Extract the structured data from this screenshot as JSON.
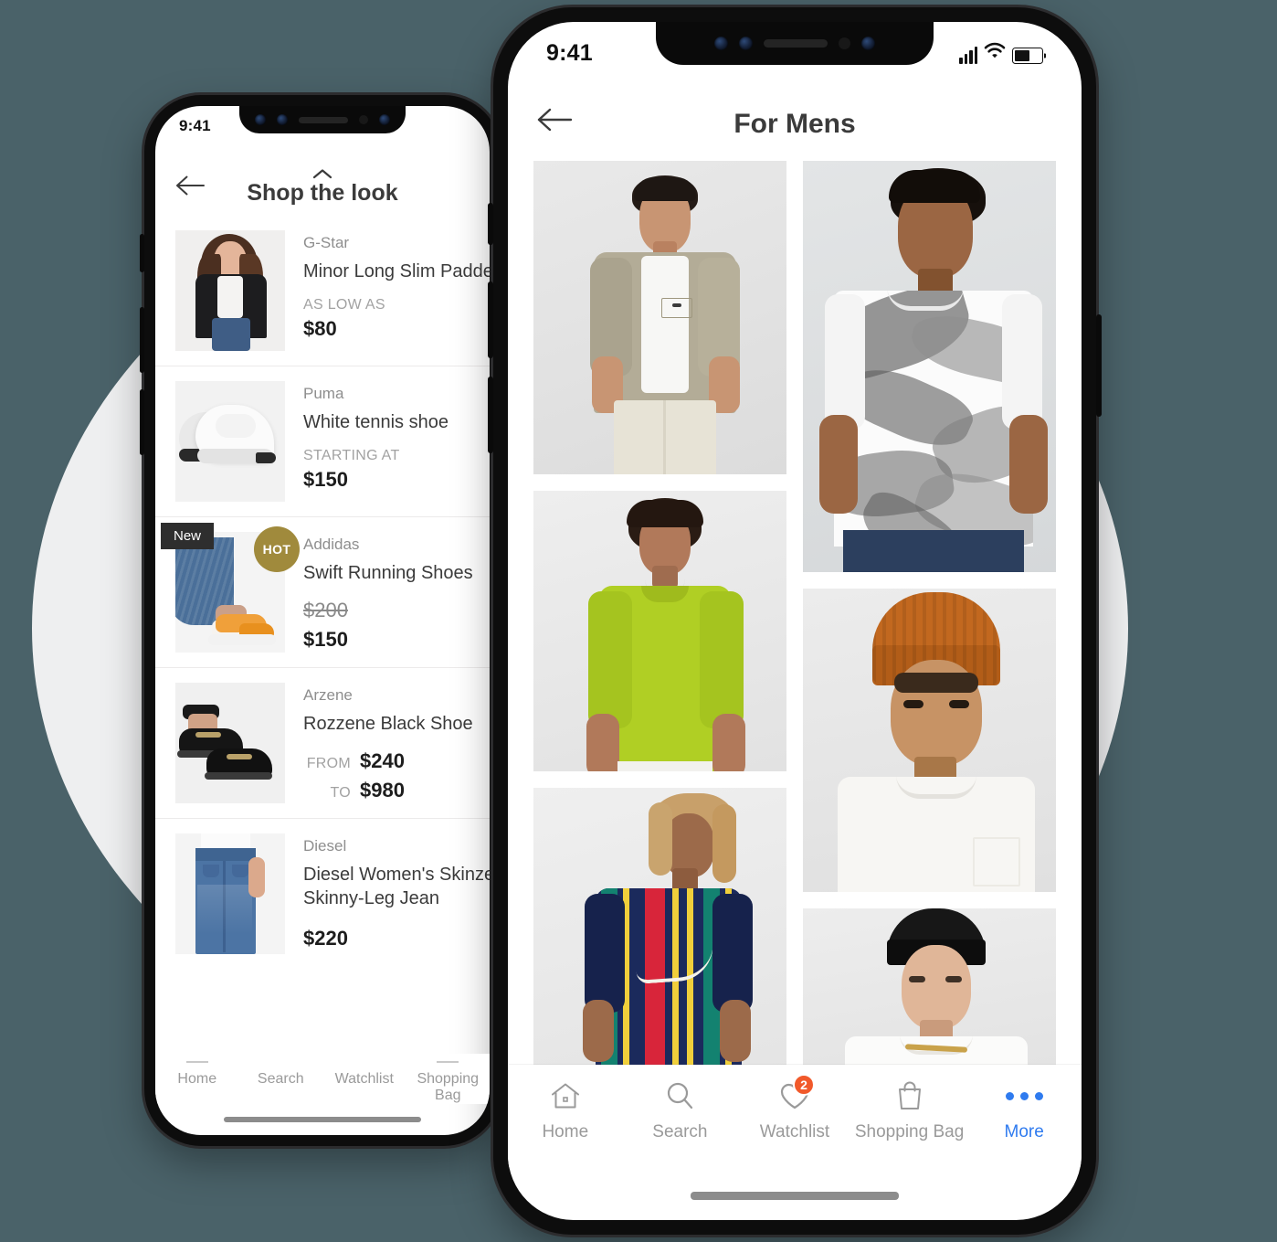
{
  "background": {
    "page_color": "#4a6269",
    "circle_color": "#eeeff0"
  },
  "left_phone": {
    "status_bar": {
      "time": "9:41"
    },
    "header": {
      "back_icon": "arrow-left-icon",
      "chevron_icon": "chevron-up-icon",
      "title": "Shop the look"
    },
    "products": [
      {
        "brand": "G-Star",
        "name": "Minor Long Slim Padded",
        "price_label": "AS LOW AS",
        "price": "$80",
        "badges": []
      },
      {
        "brand": "Puma",
        "name": "White tennis shoe",
        "price_label": "STARTING AT",
        "price": "$150",
        "badges": []
      },
      {
        "brand": "Addidas",
        "name": "Swift Running Shoes",
        "old_price": "$200",
        "price": "$150",
        "badges": [
          "New",
          "HOT"
        ],
        "badge_new_color": "#2e2e2e",
        "badge_hot_color": "#a08a3c"
      },
      {
        "brand": "Arzene",
        "name": "Rozzene Black Shoe",
        "from_label": "FROM",
        "from_price": "$240",
        "to_label": "TO",
        "to_price": "$980",
        "badges": []
      },
      {
        "brand": "Diesel",
        "name": "Diesel Women's Skinzee Skinny-Leg Jean",
        "price": "$220",
        "badges": []
      }
    ],
    "tab_bar": [
      {
        "label": "Home"
      },
      {
        "label": "Search"
      },
      {
        "label": "Watchlist"
      },
      {
        "label": "Shopping Bag"
      }
    ]
  },
  "right_phone": {
    "status_bar": {
      "time": "9:41",
      "signal_icon": "cellular-signal-icon",
      "wifi_icon": "wifi-icon",
      "battery_icon": "battery-icon"
    },
    "header": {
      "back_icon": "arrow-left-icon",
      "title": "For Mens"
    },
    "grid": {
      "left_column": [
        {
          "alt": "Man in beige short-sleeve overshirt and white tee"
        },
        {
          "alt": "Man in lime green t-shirt with chain necklace"
        },
        {
          "alt": "Man in multicolour striped Karl Kani t-shirt"
        }
      ],
      "right_column": [
        {
          "alt": "Man in white tropical print t-shirt"
        },
        {
          "alt": "Man in orange beanie and white t-shirt"
        },
        {
          "alt": "Man in black beanie and white sex slogan t-shirt"
        }
      ]
    },
    "tab_bar": [
      {
        "label": "Home",
        "icon": "home-icon",
        "active": false
      },
      {
        "label": "Search",
        "icon": "search-icon",
        "active": false
      },
      {
        "label": "Watchlist",
        "icon": "heart-icon",
        "active": false,
        "badge": "2",
        "badge_color": "#f1592a"
      },
      {
        "label": "Shopping Bag",
        "icon": "shopping-bag-icon",
        "active": false
      },
      {
        "label": "More",
        "icon": "ellipsis-icon",
        "active": true,
        "accent_color": "#2f7bef"
      }
    ]
  }
}
